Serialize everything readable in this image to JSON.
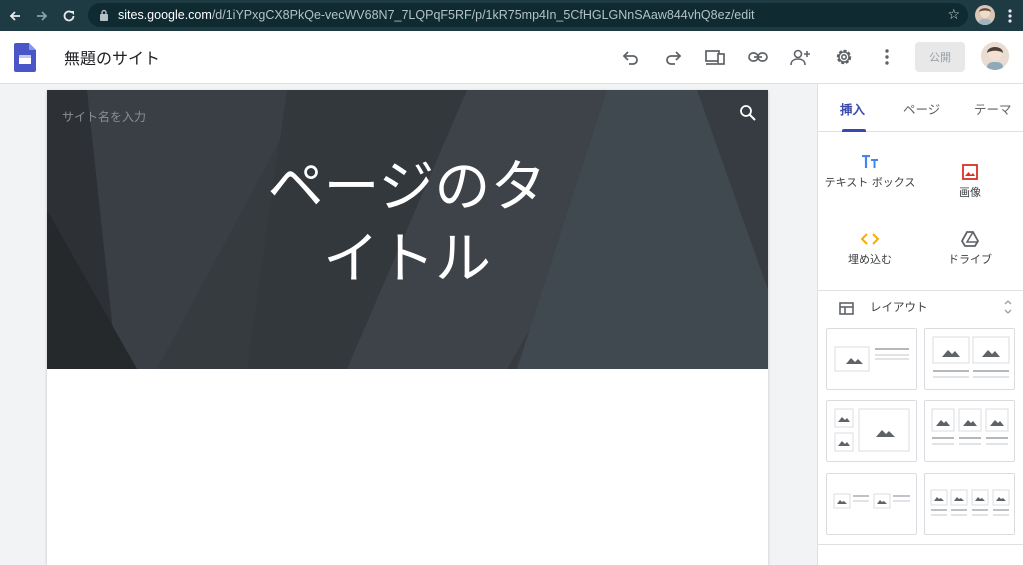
{
  "browser": {
    "url_host": "sites.google.com",
    "url_path": "/d/1iYPxgCX8PkQe-vecWV68N7_7LQPqF5RF/p/1kR75mp4In_5CfHGLGNnSAaw844vhQ8ez/edit"
  },
  "app": {
    "site_title": "無題のサイト",
    "publish_label": "公開"
  },
  "page": {
    "site_name_placeholder": "サイト名を入力",
    "title_line1": "ページのタ",
    "title_line2": "イトル"
  },
  "panel": {
    "tabs": [
      {
        "label": "挿入",
        "active": true
      },
      {
        "label": "ページ",
        "active": false
      },
      {
        "label": "テーマ",
        "active": false
      }
    ],
    "insert_items": [
      {
        "label": "テキスト ボックス",
        "icon": "text-box-icon"
      },
      {
        "label": "画像",
        "icon": "image-icon"
      },
      {
        "label": "埋め込む",
        "icon": "embed-icon"
      },
      {
        "label": "ドライブ",
        "icon": "drive-icon"
      }
    ],
    "layout_label": "レイアウト"
  },
  "colors": {
    "accent": "#3949ab",
    "browser_bar": "#1e3b44",
    "header_bg": "#353a3f",
    "embed_icon": "#f9ab00",
    "image_icon": "#d93025"
  }
}
